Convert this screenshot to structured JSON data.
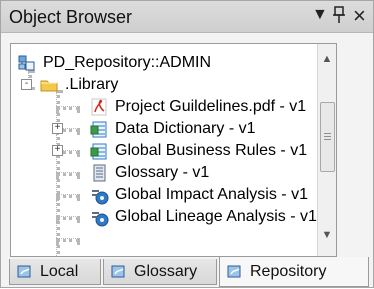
{
  "panel": {
    "title": "Object Browser",
    "buttons": [
      {
        "name": "dropdown",
        "glyph": "▼"
      },
      {
        "name": "pin",
        "glyph": "ᵃ"
      },
      {
        "name": "close",
        "glyph": "×"
      }
    ]
  },
  "tree": {
    "root": {
      "label": "PD_Repository::ADMIN",
      "icon": "repository-icon"
    },
    "library": {
      "label": ".Library",
      "icon": "folder-icon"
    },
    "items": [
      {
        "label": "Project Guildelines.pdf - v1",
        "icon": "pdf-icon",
        "has_expander": false
      },
      {
        "label": "Data Dictionary - v1",
        "icon": "dictionary-icon",
        "has_expander": true
      },
      {
        "label": "Global Business Rules - v1",
        "icon": "dictionary-icon",
        "has_expander": true
      },
      {
        "label": "Glossary - v1",
        "icon": "glossary-icon",
        "has_expander": false
      },
      {
        "label": "Global Impact Analysis - v1",
        "icon": "impact-analysis-icon",
        "has_expander": false
      },
      {
        "label": "Global Lineage Analysis - v1",
        "icon": "impact-analysis-icon",
        "has_expander": false
      }
    ],
    "expander_plus": "+",
    "expander_minus": "-"
  },
  "scrollbar": {
    "up": "▲",
    "down": "▼"
  },
  "tabs": [
    {
      "label": "Local",
      "active": false
    },
    {
      "label": "Glossary",
      "active": false
    },
    {
      "label": "Repository",
      "active": true
    }
  ],
  "colors": {
    "pdf": "#d12a1e",
    "folder": "#f3c84b",
    "blue": "#2f79c8",
    "green": "#3a9b49",
    "gray": "#5d6c7a"
  }
}
